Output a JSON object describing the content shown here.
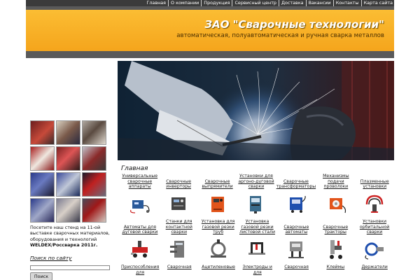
{
  "nav": {
    "items": [
      "Главная",
      "О компании",
      "Продукция",
      "Сервисный центр",
      "Доставка",
      "Вакансии",
      "Контакты",
      "Карта сайта"
    ]
  },
  "header": {
    "title": "ЗАО \"Сварочные технологии\"",
    "subtitle": "автоматическая, полуавтоматическая и ручная сварка металлов"
  },
  "sidebar": {
    "expo_text": "Посетите наш стенд на 11-ой выставке сварочных материалов, оборудования и технологий",
    "expo_bold": "WELDEX/Россварка 2011г.",
    "search_title": "Поиск по сайту",
    "search_value": "",
    "search_button": "Поиск"
  },
  "main": {
    "title": "Главная"
  },
  "catalog": {
    "rows": [
      [
        {
          "label": "Универсальные сварочные аппараты",
          "icon": "welding-machine-set-icon",
          "color": "#2a5a9a"
        },
        {
          "label": "Сварочные инверторы",
          "icon": "inverter-icon",
          "color": "#444444"
        },
        {
          "label": "Сварочные выпрямители",
          "icon": "rectifier-icon",
          "color": "#e2541b"
        },
        {
          "label": "Установки для аргоно-дуговой сварки",
          "icon": "argon-unit-icon",
          "color": "#3a6a8a"
        },
        {
          "label": "Сварочные трансформаторы",
          "icon": "transformer-icon",
          "color": "#1f4fae"
        },
        {
          "label": "Механизмы подачи проволоки",
          "icon": "wire-feeder-icon",
          "color": "#e2541b"
        },
        {
          "label": "Плазменные установки",
          "icon": "plasma-unit-icon",
          "color": "#cc2222"
        }
      ],
      [
        {
          "label": "Автоматы для дуговой сварки",
          "icon": "arc-welding-tractor-icon",
          "color": "#cc2222"
        },
        {
          "label": "Станки для контактной сварки",
          "icon": "spot-welder-icon",
          "color": "#777777"
        },
        {
          "label": "Установка для газовой резки труб",
          "icon": "pipe-cutter-icon",
          "color": "#6a6a6a"
        },
        {
          "label": "Установка газовой резки листовой стали",
          "icon": "sheet-cutter-icon",
          "color": "#2a2a2a"
        },
        {
          "label": "Сварочные автоматы",
          "icon": "welding-automat-icon",
          "color": "#8a8a8a"
        },
        {
          "label": "Сварочные тракторы",
          "icon": "welding-tractor-icon",
          "color": "#999999"
        },
        {
          "label": "Установки орбитальной сварки",
          "icon": "orbital-welder-icon",
          "color": "#1f4fae"
        }
      ],
      [
        {
          "label": "Приспособления для",
          "icon": "",
          "color": "#000000"
        },
        {
          "label": "Сварочная",
          "icon": "",
          "color": "#000000"
        },
        {
          "label": "Ацетиленовые",
          "icon": "",
          "color": "#000000"
        },
        {
          "label": "Электроды и для",
          "icon": "",
          "color": "#000000"
        },
        {
          "label": "Сварочная",
          "icon": "",
          "color": "#000000"
        },
        {
          "label": "Клеймы",
          "icon": "",
          "color": "#000000"
        },
        {
          "label": "Держатели",
          "icon": "",
          "color": "#000000"
        }
      ]
    ]
  }
}
